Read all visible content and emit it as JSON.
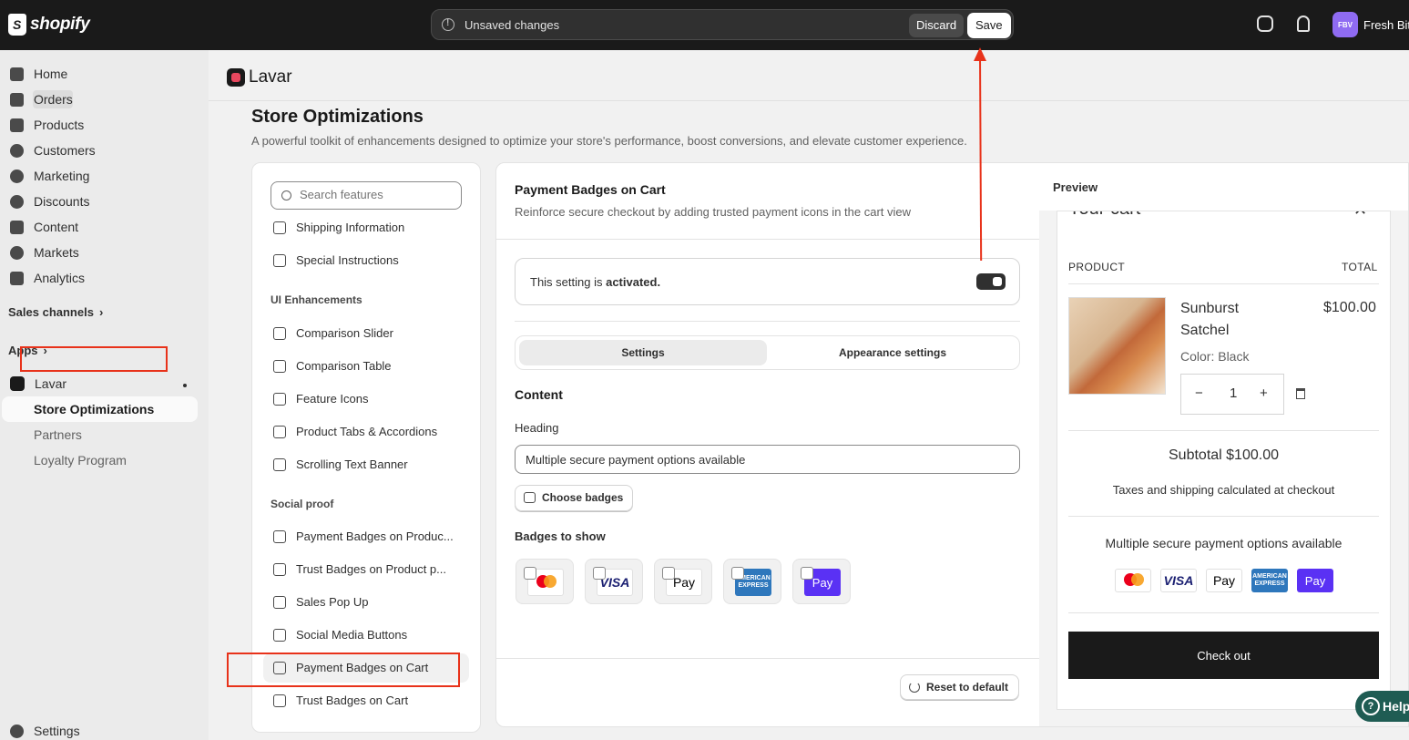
{
  "topbar": {
    "brand": "shopify",
    "unsaved_message": "Unsaved changes",
    "discard_label": "Discard",
    "save_label": "Save",
    "avatar_initials": "FBV",
    "account_name": "Fresh Bite"
  },
  "nav": {
    "items": [
      {
        "label": "Home",
        "icon": "home-icon"
      },
      {
        "label": "Orders",
        "icon": "inbox-icon"
      },
      {
        "label": "Products",
        "icon": "tag-icon"
      },
      {
        "label": "Customers",
        "icon": "person-icon"
      },
      {
        "label": "Marketing",
        "icon": "target-icon"
      },
      {
        "label": "Discounts",
        "icon": "discount-icon"
      },
      {
        "label": "Content",
        "icon": "monitor-icon"
      },
      {
        "label": "Markets",
        "icon": "globe-icon"
      },
      {
        "label": "Analytics",
        "icon": "bar-chart-icon"
      }
    ],
    "sales_channels": "Sales channels",
    "apps": "Apps",
    "app_name": "Lavar",
    "app_sub": [
      "Store Optimizations",
      "Partners",
      "Loyalty Program"
    ],
    "settings": "Settings"
  },
  "app_header": {
    "name": "Lavar"
  },
  "page": {
    "title": "Store Optimizations",
    "subtitle": "A powerful toolkit of enhancements designed to optimize your store's performance, boost conversions, and elevate customer experience."
  },
  "features": {
    "search_placeholder": "Search features",
    "top_items": [
      "Shipping Information",
      "Special Instructions"
    ],
    "groups": [
      {
        "title": "UI Enhancements",
        "items": [
          "Comparison Slider",
          "Comparison Table",
          "Feature Icons",
          "Product Tabs & Accordions",
          "Scrolling Text Banner"
        ]
      },
      {
        "title": "Social proof",
        "items": [
          "Payment Badges on Produc...",
          "Trust Badges on Product p...",
          "Sales Pop Up",
          "Social Media Buttons",
          "Payment Badges on Cart",
          "Trust Badges on Cart"
        ]
      }
    ]
  },
  "settings": {
    "title": "Payment Badges on Cart",
    "subtitle": "Reinforce secure checkout by adding trusted payment icons in the cart view",
    "activated_prefix": "This setting is ",
    "activated_bold": "activated.",
    "toggle_on": true,
    "tabs": [
      "Settings",
      "Appearance settings"
    ],
    "content_heading": "Content",
    "heading_label": "Heading",
    "heading_value": "Multiple secure payment options available",
    "choose_badges": "Choose badges",
    "badges_to_show": "Badges to show",
    "badges": [
      {
        "name": "mastercard",
        "label": "mastercard"
      },
      {
        "name": "visa",
        "label": "VISA"
      },
      {
        "name": "apple-pay",
        "label": "Pay"
      },
      {
        "name": "amex",
        "label": "AMERICAN EXPRESS"
      },
      {
        "name": "opay",
        "label": "Pay"
      }
    ],
    "reset": "Reset to default"
  },
  "preview": {
    "label": "Preview",
    "cart_title": "Your cart",
    "col_product": "PRODUCT",
    "col_total": "TOTAL",
    "product_name": "Sunburst Satchel",
    "product_price": "$100.00",
    "product_variant": "Color: Black",
    "qty_minus": "−",
    "quantity": "1",
    "qty_plus": "+",
    "subtotal": "Subtotal $100.00",
    "taxes": "Taxes and shipping calculated at checkout",
    "secure_heading": "Multiple secure payment options available",
    "checkout": "Check out"
  },
  "help": "Help",
  "colors": {
    "accent_red": "#e8321a",
    "topbar": "#1a1a1a",
    "opay": "#5a31f4"
  }
}
